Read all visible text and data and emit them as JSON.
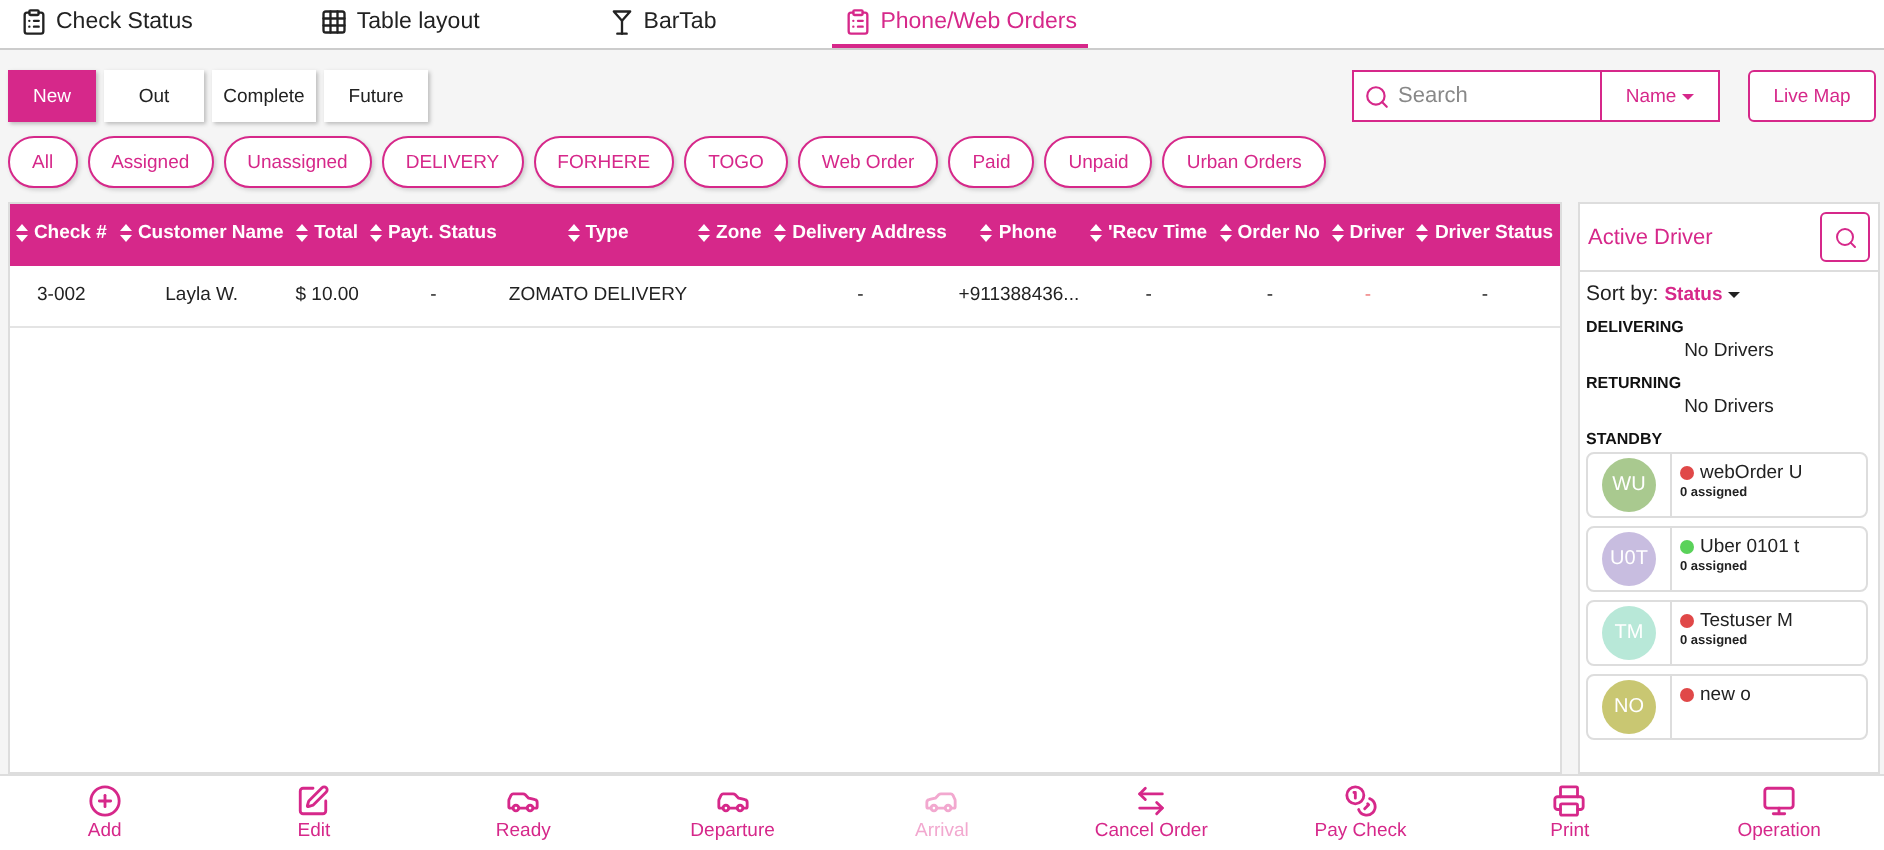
{
  "top_tabs": [
    {
      "label": "Check Status",
      "selected": false
    },
    {
      "label": "Table layout",
      "selected": false
    },
    {
      "label": "BarTab",
      "selected": false
    },
    {
      "label": "Phone/Web Orders",
      "selected": true
    }
  ],
  "status_tabs": [
    {
      "label": "New",
      "selected": true
    },
    {
      "label": "Out",
      "selected": false
    },
    {
      "label": "Complete",
      "selected": false
    },
    {
      "label": "Future",
      "selected": false
    }
  ],
  "search": {
    "placeholder": "Search",
    "field": "Name"
  },
  "live_map": "Live Map",
  "filters": [
    "All",
    "Assigned",
    "Unassigned",
    "DELIVERY",
    "FORHERE",
    "TOGO",
    "Web Order",
    "Paid",
    "Unpaid",
    "Urban Orders"
  ],
  "table": {
    "columns": [
      "Check #",
      "Customer Name",
      "Total",
      "Payt. Status",
      "Type",
      "Zone",
      "Delivery Address",
      "Phone",
      "'Recv Time",
      "Order No",
      "Driver",
      "Driver Status"
    ],
    "rows": [
      [
        "3-002",
        "Layla W.",
        "$ 10.00",
        "-",
        "ZOMATO DELIVERY",
        "",
        "-",
        "+911388436...",
        "-",
        "-",
        "-",
        "-"
      ]
    ]
  },
  "drivers_panel": {
    "title": "Active Driver",
    "sort_label": "Sort by:",
    "sort_value": "Status",
    "groups": [
      {
        "name": "DELIVERING",
        "empty": "No Drivers"
      },
      {
        "name": "RETURNING",
        "empty": "No Drivers"
      },
      {
        "name": "STANDBY",
        "drivers": [
          {
            "initials": "WU",
            "name": "webOrder U",
            "assigned": "0 assigned",
            "color": "#e04848"
          },
          {
            "initials": "U0T",
            "name": "Uber 0101 t",
            "assigned": "0 assigned",
            "color": "#5ad25a"
          },
          {
            "initials": "TM",
            "name": "Testuser M",
            "assigned": "0 assigned",
            "color": "#e04848"
          },
          {
            "initials": "NO",
            "name": "new o",
            "color": "#e04848"
          }
        ]
      }
    ]
  },
  "actions": [
    {
      "label": "Add",
      "disabled": false
    },
    {
      "label": "Edit",
      "disabled": false
    },
    {
      "label": "Ready",
      "disabled": false
    },
    {
      "label": "Departure",
      "disabled": false
    },
    {
      "label": "Arrival",
      "disabled": true
    },
    {
      "label": "Cancel Order",
      "disabled": false
    },
    {
      "label": "Pay Check",
      "disabled": false
    },
    {
      "label": "Print",
      "disabled": false
    },
    {
      "label": "Operation",
      "disabled": false
    }
  ]
}
